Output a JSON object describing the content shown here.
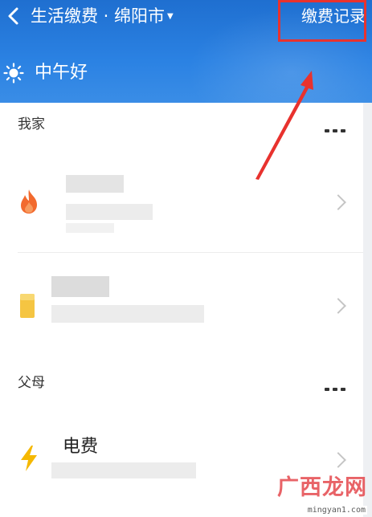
{
  "header": {
    "title": "生活缴费 · 绵阳市",
    "dropdown_icon": "caret-down-icon",
    "back_icon": "back-chevron-icon",
    "right_link": "缴费记录",
    "greeting": "中午好",
    "weather_icon": "sun-icon"
  },
  "colors": {
    "header_blue": "#2b82e3",
    "highlight_red": "#e8322e",
    "gas_orange": "#f26a2e",
    "water_yellow": "#f5c542",
    "power_yellow": "#f5b800"
  },
  "sections": [
    {
      "title": "我家",
      "items": [
        {
          "icon": "flame-icon",
          "name": ""
        },
        {
          "icon": "water-icon",
          "name": ""
        }
      ]
    },
    {
      "title": "父母",
      "items": [
        {
          "icon": "lightning-icon",
          "name": "电费"
        }
      ]
    }
  ],
  "watermark": {
    "text": "广西龙网",
    "url": "mingyan1.com"
  }
}
